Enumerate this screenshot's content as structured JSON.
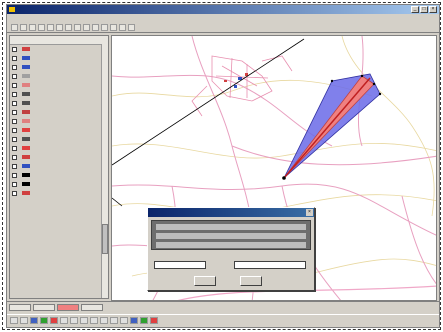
{
  "window": {
    "title": "",
    "menu_items": [
      "",
      "",
      "",
      "",
      "",
      "",
      "",
      "",
      "",
      "",
      ""
    ]
  },
  "toc": {
    "header": "",
    "layers": [
      {
        "label": "",
        "symbol_color": "#d04040"
      },
      {
        "label": "",
        "symbol_color": "#3050c0"
      },
      {
        "label": "",
        "symbol_color": "#3050c0"
      },
      {
        "label": "",
        "symbol_color": "#a0a0a0"
      },
      {
        "label": "",
        "symbol_color": "#e08080"
      },
      {
        "label": "",
        "symbol_color": "#505050"
      },
      {
        "label": "",
        "symbol_color": "#505050"
      },
      {
        "label": "",
        "symbol_color": "#c04040"
      },
      {
        "label": "",
        "symbol_color": "#e08080"
      },
      {
        "label": "",
        "symbol_color": "#e04040"
      },
      {
        "label": "",
        "symbol_color": "#505050"
      },
      {
        "label": "",
        "symbol_color": "#e04040"
      },
      {
        "label": "",
        "symbol_color": "#d04040"
      },
      {
        "label": "",
        "symbol_color": "#3050c0"
      },
      {
        "label": "",
        "symbol_color": "#000000"
      },
      {
        "label": "",
        "symbol_color": "#000000"
      },
      {
        "label": "",
        "symbol_color": "#d04040"
      }
    ]
  },
  "dialog": {
    "title": "",
    "field1_label": "",
    "field1_value": "",
    "field2_label": "",
    "field2_value": "",
    "ok_label": "",
    "cancel_label": ""
  },
  "status_tabs": [
    "",
    "",
    "",
    ""
  ],
  "colors": {
    "road": "#e8a0c0",
    "contour": "#e8d8a0",
    "fan_fill": "#6a6ae8",
    "corridor": "#f08080",
    "accent_titlebar": "#0a246a"
  }
}
